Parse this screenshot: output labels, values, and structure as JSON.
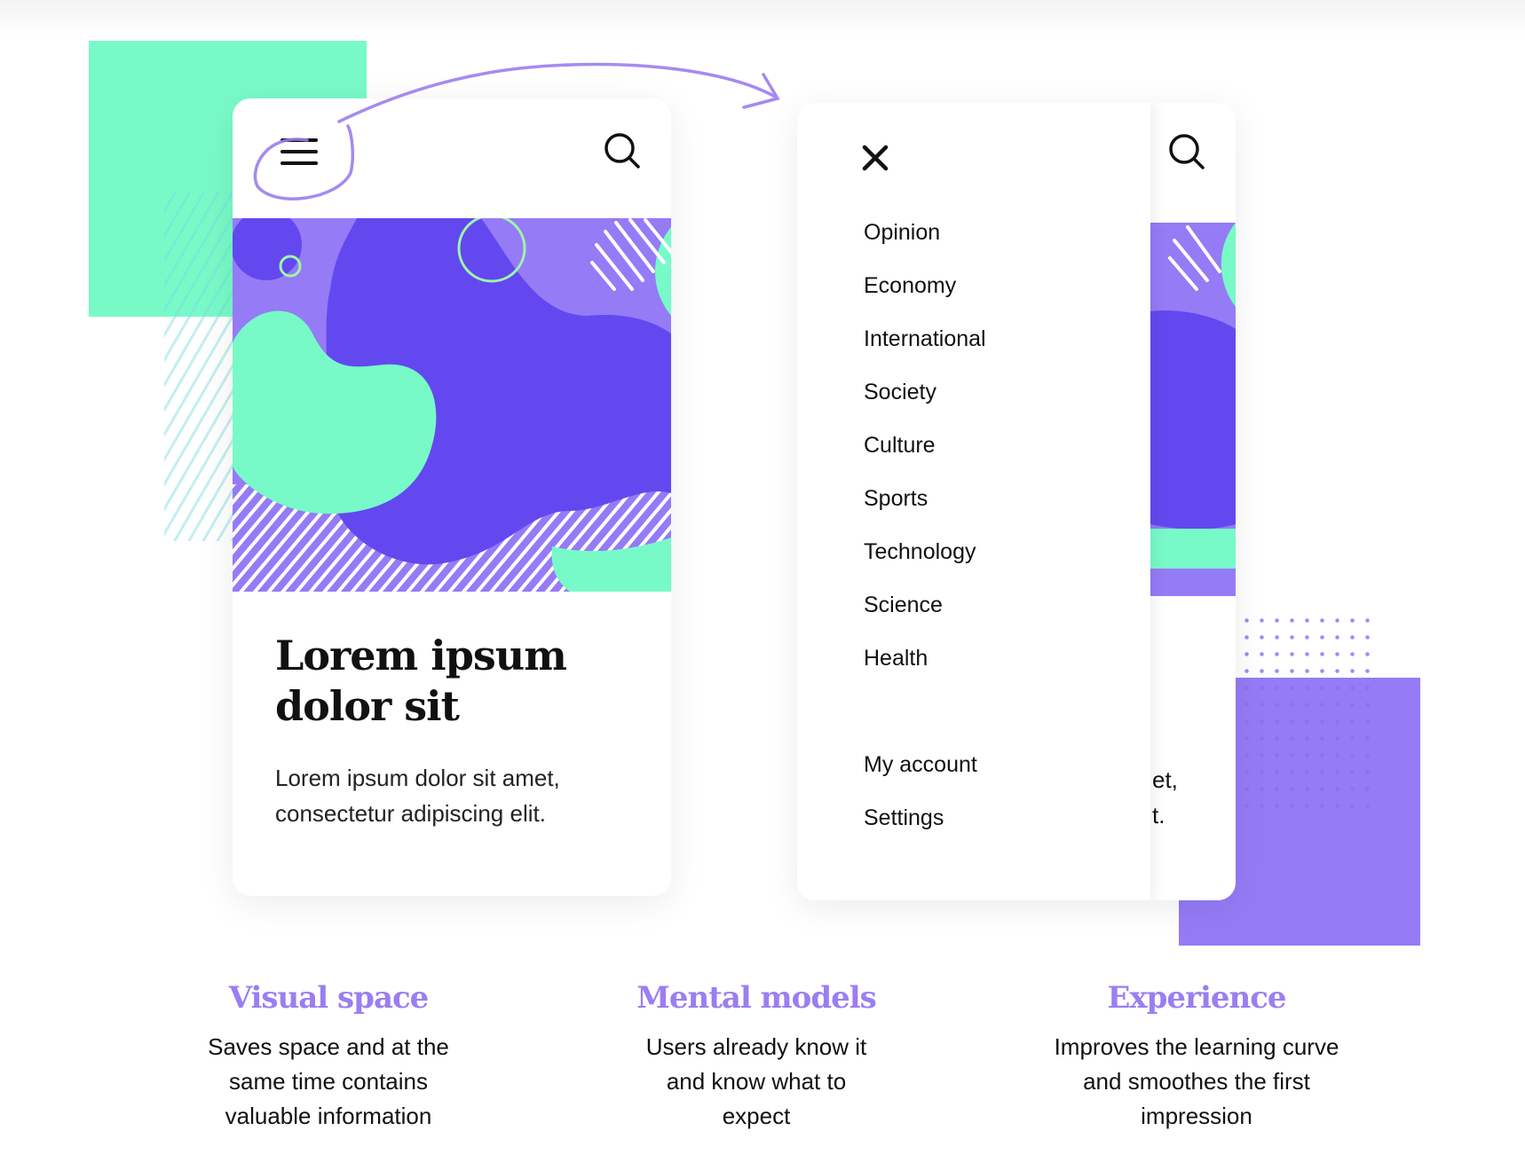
{
  "colors": {
    "green": "#78fac8",
    "purple_light": "#957bf6",
    "purple_dark": "#6348f0",
    "accent_text": "#9b7ef0"
  },
  "card_closed": {
    "menu_icon": "hamburger-icon",
    "search_icon": "search-icon",
    "title": "Lorem ipsum dolor sit",
    "body": "Lorem ipsum dolor sit amet, consectetur adipiscing elit."
  },
  "card_open": {
    "close_icon": "close-icon",
    "search_icon": "search-icon",
    "menu_items": [
      "Opinion",
      "Economy",
      "International",
      "Society",
      "Culture",
      "Sports",
      "Technology",
      "Science",
      "Health"
    ],
    "account_items": [
      "My account",
      "Settings"
    ],
    "peek_text_1": "et,",
    "peek_text_2": "t."
  },
  "features": [
    {
      "title": "Visual space",
      "text": "Saves space and at the same time contains valuable information"
    },
    {
      "title": "Mental models",
      "text": "Users already know it and know what to expect"
    },
    {
      "title": "Experience",
      "text": "Improves the learning curve and smoothes the first impression"
    }
  ]
}
